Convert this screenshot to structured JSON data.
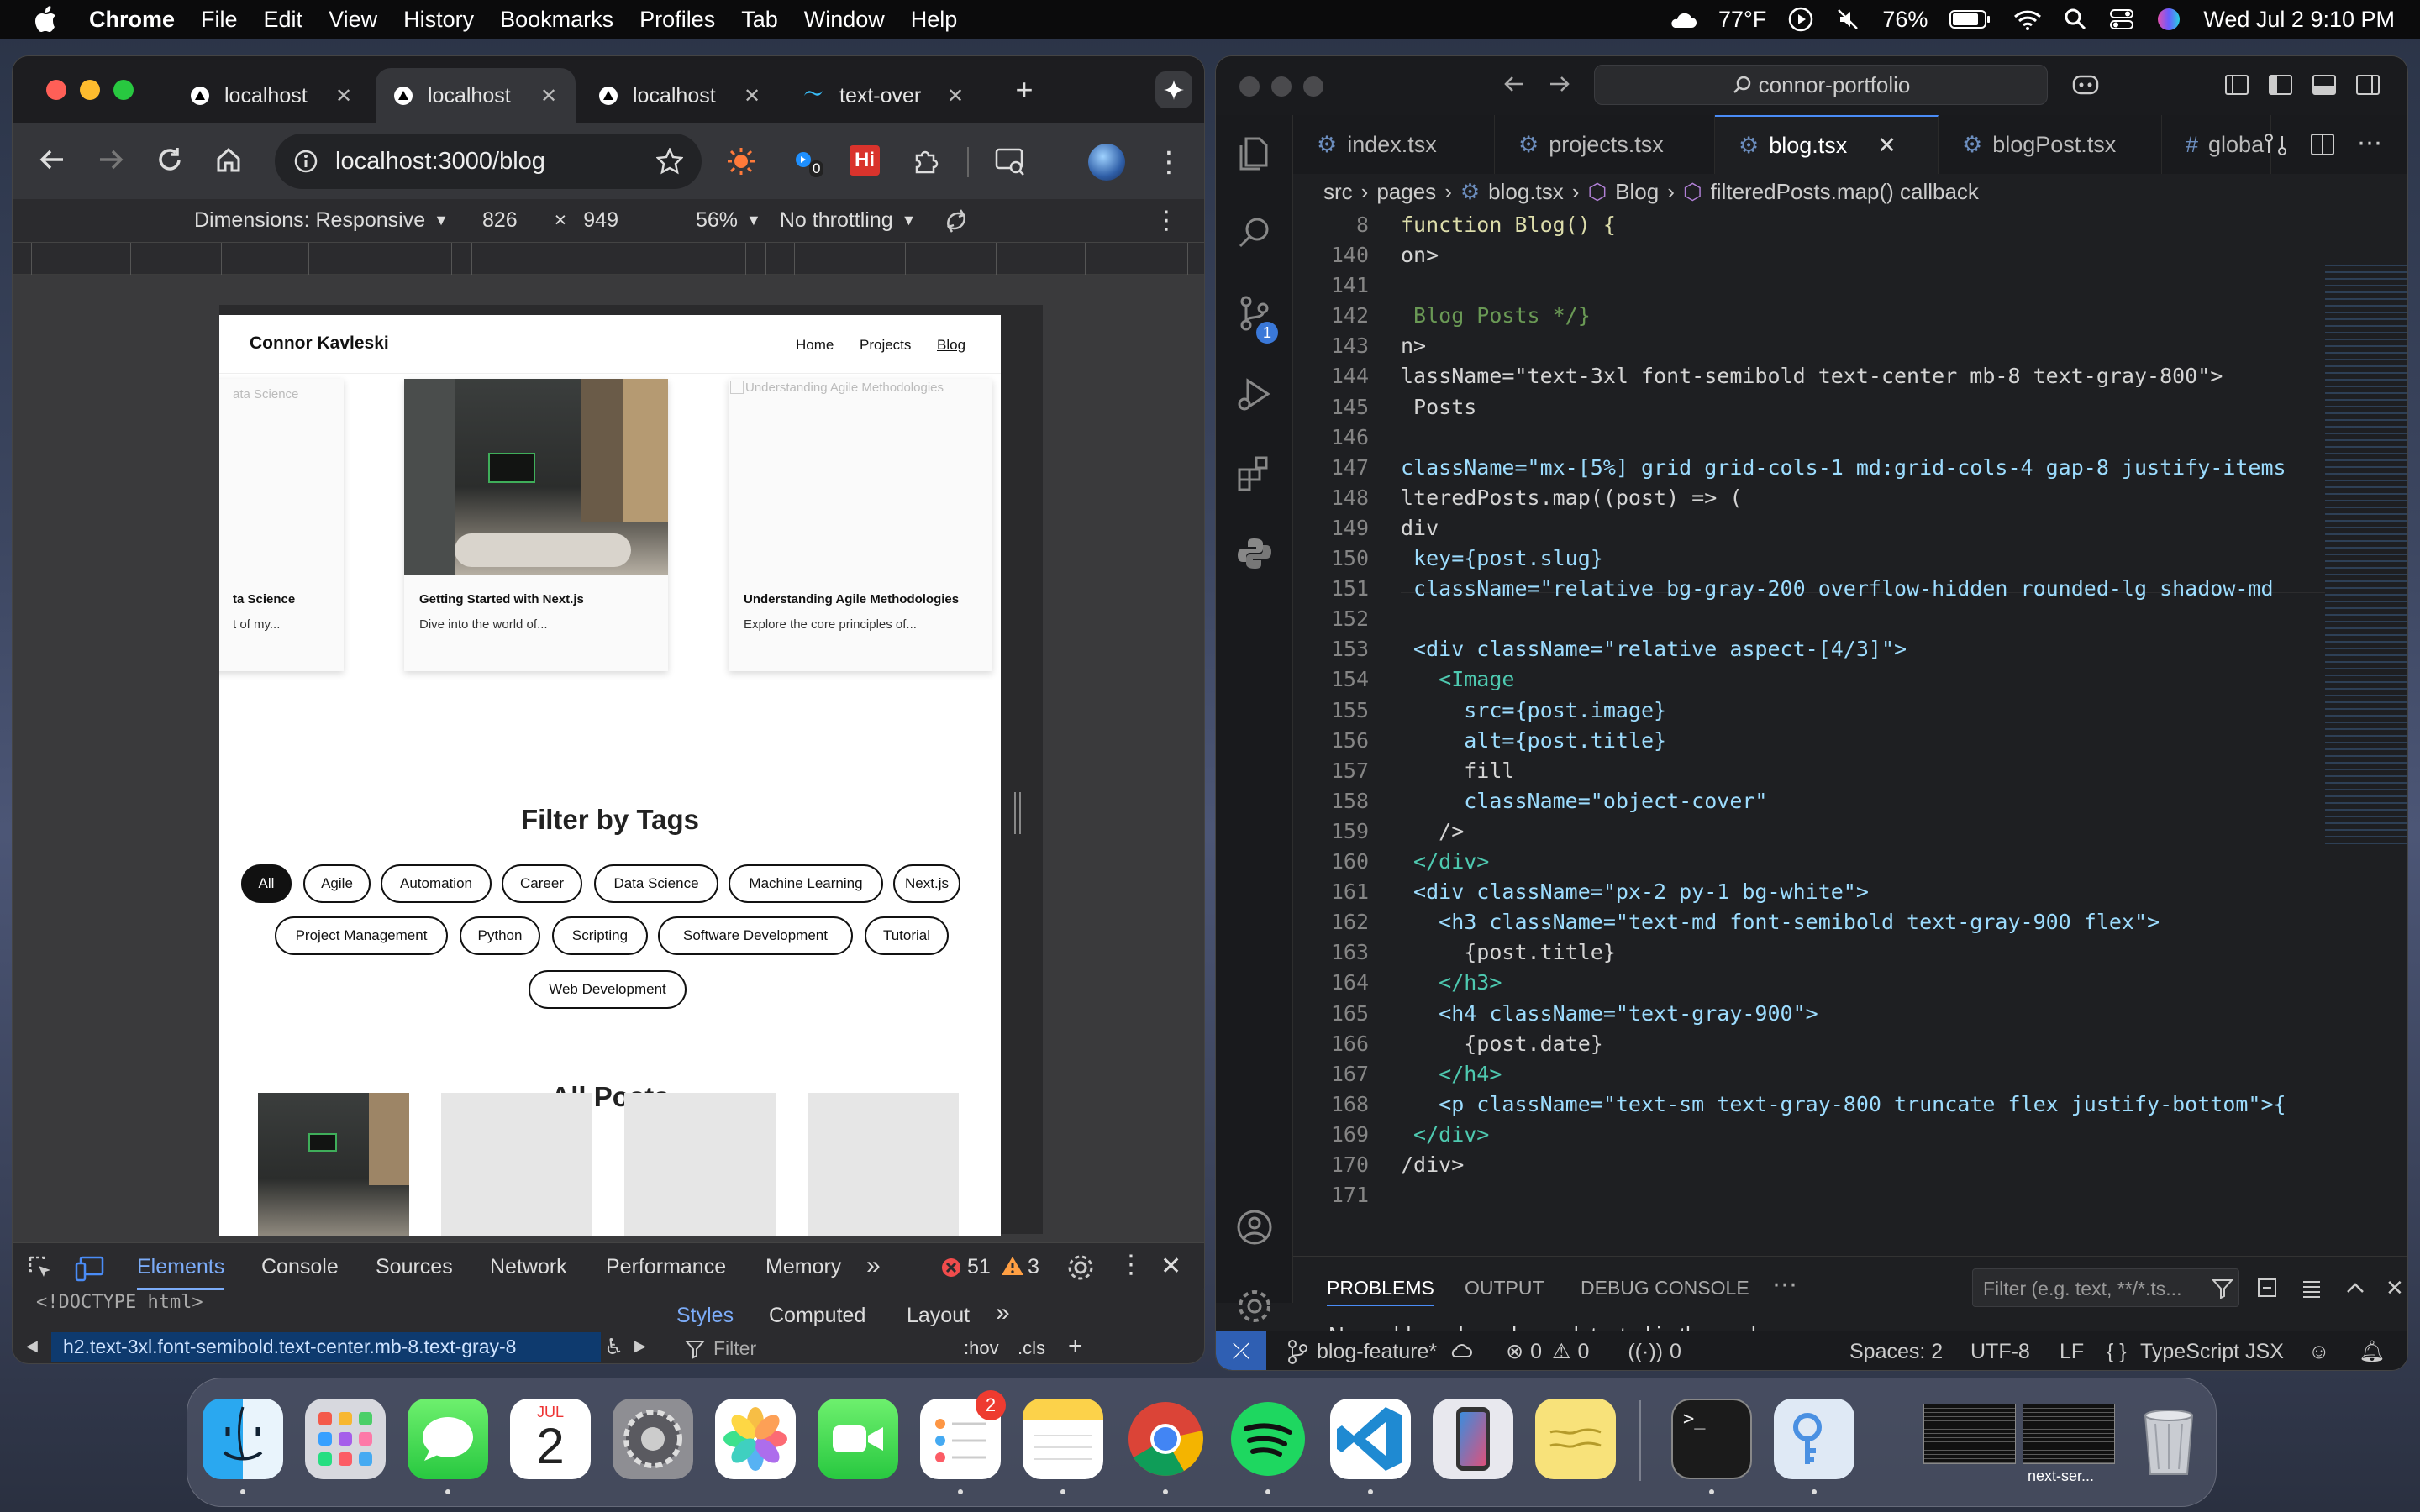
{
  "menubar": {
    "app": "Chrome",
    "items": [
      "File",
      "Edit",
      "View",
      "History",
      "Bookmarks",
      "Profiles",
      "Tab",
      "Window",
      "Help"
    ],
    "weather": "77°F",
    "battery": "76%",
    "datetime": "Wed Jul 2  9:10 PM"
  },
  "browser": {
    "tabs": [
      {
        "title": "localhost",
        "active": false
      },
      {
        "title": "localhost",
        "active": true
      },
      {
        "title": "localhost",
        "active": false
      },
      {
        "title": "text-over",
        "active": false
      }
    ],
    "url": "localhost:3000/blog",
    "extension_badge": "0",
    "devbar": {
      "dimensions_label": "Dimensions: Responsive",
      "width": "826",
      "times": "×",
      "height": "949",
      "zoom": "56%",
      "throttling": "No throttling"
    },
    "devtools": {
      "tabs": [
        "Elements",
        "Console",
        "Sources",
        "Network",
        "Performance",
        "Memory"
      ],
      "errors": "51",
      "warnings": "3",
      "doctype": "<!DOCTYPE html>",
      "selected_node": "h2.text-3xl.font-semibold.text-center.mb-8.text-gray-8",
      "style_tabs": [
        "Styles",
        "Computed",
        "Layout"
      ],
      "filter_placeholder": "Filter",
      "hov": ":hov",
      "cls": ".cls"
    }
  },
  "site": {
    "brand": "Connor Kavleski",
    "nav": [
      "Home",
      "Projects",
      "Blog"
    ],
    "carousel": [
      {
        "title": "ta Science",
        "excerpt": "t of my...",
        "alt": "ata Science"
      },
      {
        "title": "Getting Started with Next.js",
        "excerpt": "Dive into the world of..."
      },
      {
        "title": "Understanding Agile Methodologies",
        "excerpt": "Explore the core principles of...",
        "alt": "Understanding Agile Methodologies"
      }
    ],
    "filter_heading": "Filter by Tags",
    "tags_row1": [
      "All",
      "Agile",
      "Automation",
      "Career",
      "Data Science",
      "Machine Learning",
      "Next.js"
    ],
    "tags_row2": [
      "Project Management",
      "Python",
      "Scripting",
      "Software Development",
      "Tutorial"
    ],
    "tags_row3": [
      "Web Development"
    ],
    "all_posts_heading": "All Posts"
  },
  "editor": {
    "search": "connor-portfolio",
    "tabs": [
      {
        "name": "index.tsx",
        "active": false
      },
      {
        "name": "projects.tsx",
        "active": false
      },
      {
        "name": "blog.tsx",
        "active": true
      },
      {
        "name": "blogPost.tsx",
        "active": false
      },
      {
        "name": "globa",
        "active": false
      }
    ],
    "breadcrumb": [
      "src",
      "pages",
      "blog.tsx",
      "Blog",
      "filteredPosts.map() callback"
    ],
    "sticky_line": {
      "num": "8",
      "text": "function Blog() {"
    },
    "lines": [
      {
        "num": "140",
        "text": "on>"
      },
      {
        "num": "141",
        "text": ""
      },
      {
        "num": "142",
        "text": " Blog Posts */}"
      },
      {
        "num": "143",
        "text": "n>"
      },
      {
        "num": "144",
        "text": "lassName=\"text-3xl font-semibold text-center mb-8 text-gray-800\">"
      },
      {
        "num": "145",
        "text": " Posts"
      },
      {
        "num": "146",
        "text": ""
      },
      {
        "num": "147",
        "text": "className=\"mx-[5%] grid grid-cols-1 md:grid-cols-4 gap-8 justify-items"
      },
      {
        "num": "148",
        "text": "lteredPosts.map((post) => ("
      },
      {
        "num": "149",
        "text": "div"
      },
      {
        "num": "150",
        "text": " key={post.slug}"
      },
      {
        "num": "151",
        "text": " className=\"relative bg-gray-200 overflow-hidden rounded-lg shadow-md"
      },
      {
        "num": "152",
        "text": ""
      },
      {
        "num": "153",
        "text": " <div className=\"relative aspect-[4/3]\">"
      },
      {
        "num": "154",
        "text": "   <Image"
      },
      {
        "num": "155",
        "text": "     src={post.image}"
      },
      {
        "num": "156",
        "text": "     alt={post.title}"
      },
      {
        "num": "157",
        "text": "     fill"
      },
      {
        "num": "158",
        "text": "     className=\"object-cover\""
      },
      {
        "num": "159",
        "text": "   />"
      },
      {
        "num": "160",
        "text": " </div>"
      },
      {
        "num": "161",
        "text": " <div className=\"px-2 py-1 bg-white\">"
      },
      {
        "num": "162",
        "text": "   <h3 className=\"text-md font-semibold text-gray-900 flex\">"
      },
      {
        "num": "163",
        "text": "     {post.title}"
      },
      {
        "num": "164",
        "text": "   </h3>"
      },
      {
        "num": "165",
        "text": "   <h4 className=\"text-gray-900\">"
      },
      {
        "num": "166",
        "text": "     {post.date}"
      },
      {
        "num": "167",
        "text": "   </h4>"
      },
      {
        "num": "168",
        "text": "   <p className=\"text-sm text-gray-800 truncate flex justify-bottom\">{"
      },
      {
        "num": "169",
        "text": " </div>"
      },
      {
        "num": "170",
        "text": "/div>"
      },
      {
        "num": "171",
        "text": ""
      }
    ],
    "panel": {
      "tabs": [
        "PROBLEMS",
        "OUTPUT",
        "DEBUG CONSOLE"
      ],
      "filter_placeholder": "Filter (e.g. text, **/*.ts...",
      "message": "No problems have been detected in the workspace."
    },
    "status": {
      "branch": "blog-feature*",
      "errors": "0",
      "warnings": "0",
      "ports": "0",
      "spaces": "Spaces: 2",
      "encoding": "UTF-8",
      "eol": "LF",
      "language": "TypeScript JSX",
      "scm_badge": "1"
    }
  },
  "dock": {
    "calendar_month": "JUL",
    "calendar_day": "2",
    "reminders_badge": "2",
    "window_label": "next-ser..."
  },
  "colors": {
    "accent_blue": "#4a8cf7",
    "error_red": "#f14c4c",
    "warning_orange": "#ff9f43"
  }
}
